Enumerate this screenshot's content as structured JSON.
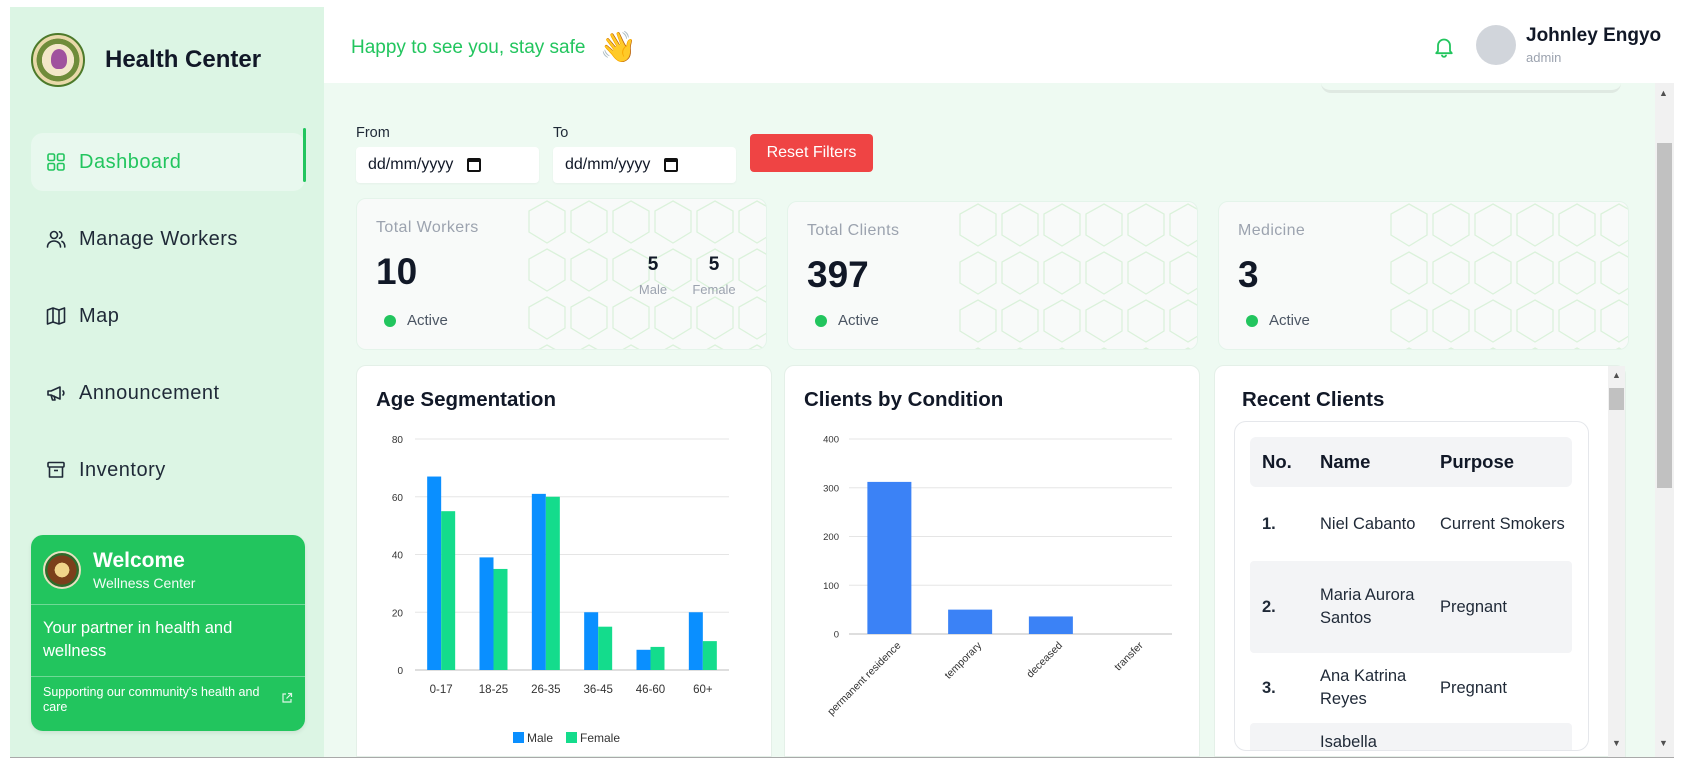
{
  "sidebar": {
    "brand": "Health Center",
    "nav": [
      {
        "label": "Dashboard",
        "icon": "dashboard-grid-icon",
        "active": true
      },
      {
        "label": "Manage Workers",
        "icon": "users-icon"
      },
      {
        "label": "Map",
        "icon": "map-icon"
      },
      {
        "label": "Announcement",
        "icon": "megaphone-icon"
      },
      {
        "label": "Inventory",
        "icon": "archive-box-icon"
      }
    ],
    "welcome": {
      "title": "Welcome",
      "subtitle": "Wellness Center",
      "tagline": "Your partner in health and wellness",
      "footer": "Supporting our community's health and care"
    }
  },
  "header": {
    "greeting": "Happy to see you, stay safe",
    "wave": "👋",
    "user_name": "Johnley Engyo",
    "user_role": "admin"
  },
  "filters": {
    "from_label": "From",
    "to_label": "To",
    "from_value": "dd/mm/yyyy",
    "to_value": "dd/mm/yyyy",
    "reset_label": "Reset Filters"
  },
  "stats": {
    "workers": {
      "label": "Total Workers",
      "value": "10",
      "status": "Active",
      "male_value": "5",
      "male_label": "Male",
      "female_value": "5",
      "female_label": "Female"
    },
    "clients": {
      "label": "Total Clients",
      "value": "397",
      "status": "Active"
    },
    "medicine": {
      "label": "Medicine",
      "value": "3",
      "status": "Active"
    }
  },
  "colors": {
    "accent": "#22c55e",
    "danger": "#ef4444",
    "male": "#0a8fff",
    "female": "#14dc8c",
    "condition_bar": "#3b82f6"
  },
  "chart_data": [
    {
      "type": "bar",
      "title": "Age Segmentation",
      "categories": [
        "0-17",
        "18-25",
        "26-35",
        "36-45",
        "46-60",
        "60+"
      ],
      "series": [
        {
          "name": "Male",
          "values": [
            67,
            39,
            61,
            20,
            7,
            20
          ]
        },
        {
          "name": "Female",
          "values": [
            55,
            35,
            60,
            15,
            8,
            10
          ]
        }
      ],
      "ylim": [
        0,
        80
      ],
      "yticks": [
        0,
        20,
        40,
        60,
        80
      ],
      "grid": true,
      "legend": "bottom"
    },
    {
      "type": "bar",
      "title": "Clients by Condition",
      "categories": [
        "permanent residence",
        "temporary",
        "deceased",
        "transfer"
      ],
      "values": [
        312,
        50,
        36,
        0
      ],
      "ylim": [
        0,
        400
      ],
      "yticks": [
        0,
        100,
        200,
        300,
        400
      ],
      "grid": true
    }
  ],
  "recent_clients": {
    "title": "Recent Clients",
    "columns": [
      "No.",
      "Name",
      "Purpose"
    ],
    "rows": [
      {
        "no": "1.",
        "name": "Niel Cabanto",
        "purpose": "Current Smokers"
      },
      {
        "no": "2.",
        "name": "Maria Aurora Santos",
        "purpose": "Pregnant"
      },
      {
        "no": "3.",
        "name": "Ana Katrina Reyes",
        "purpose": "Pregnant"
      },
      {
        "no": "",
        "name": "Isabella",
        "purpose": ""
      }
    ]
  }
}
